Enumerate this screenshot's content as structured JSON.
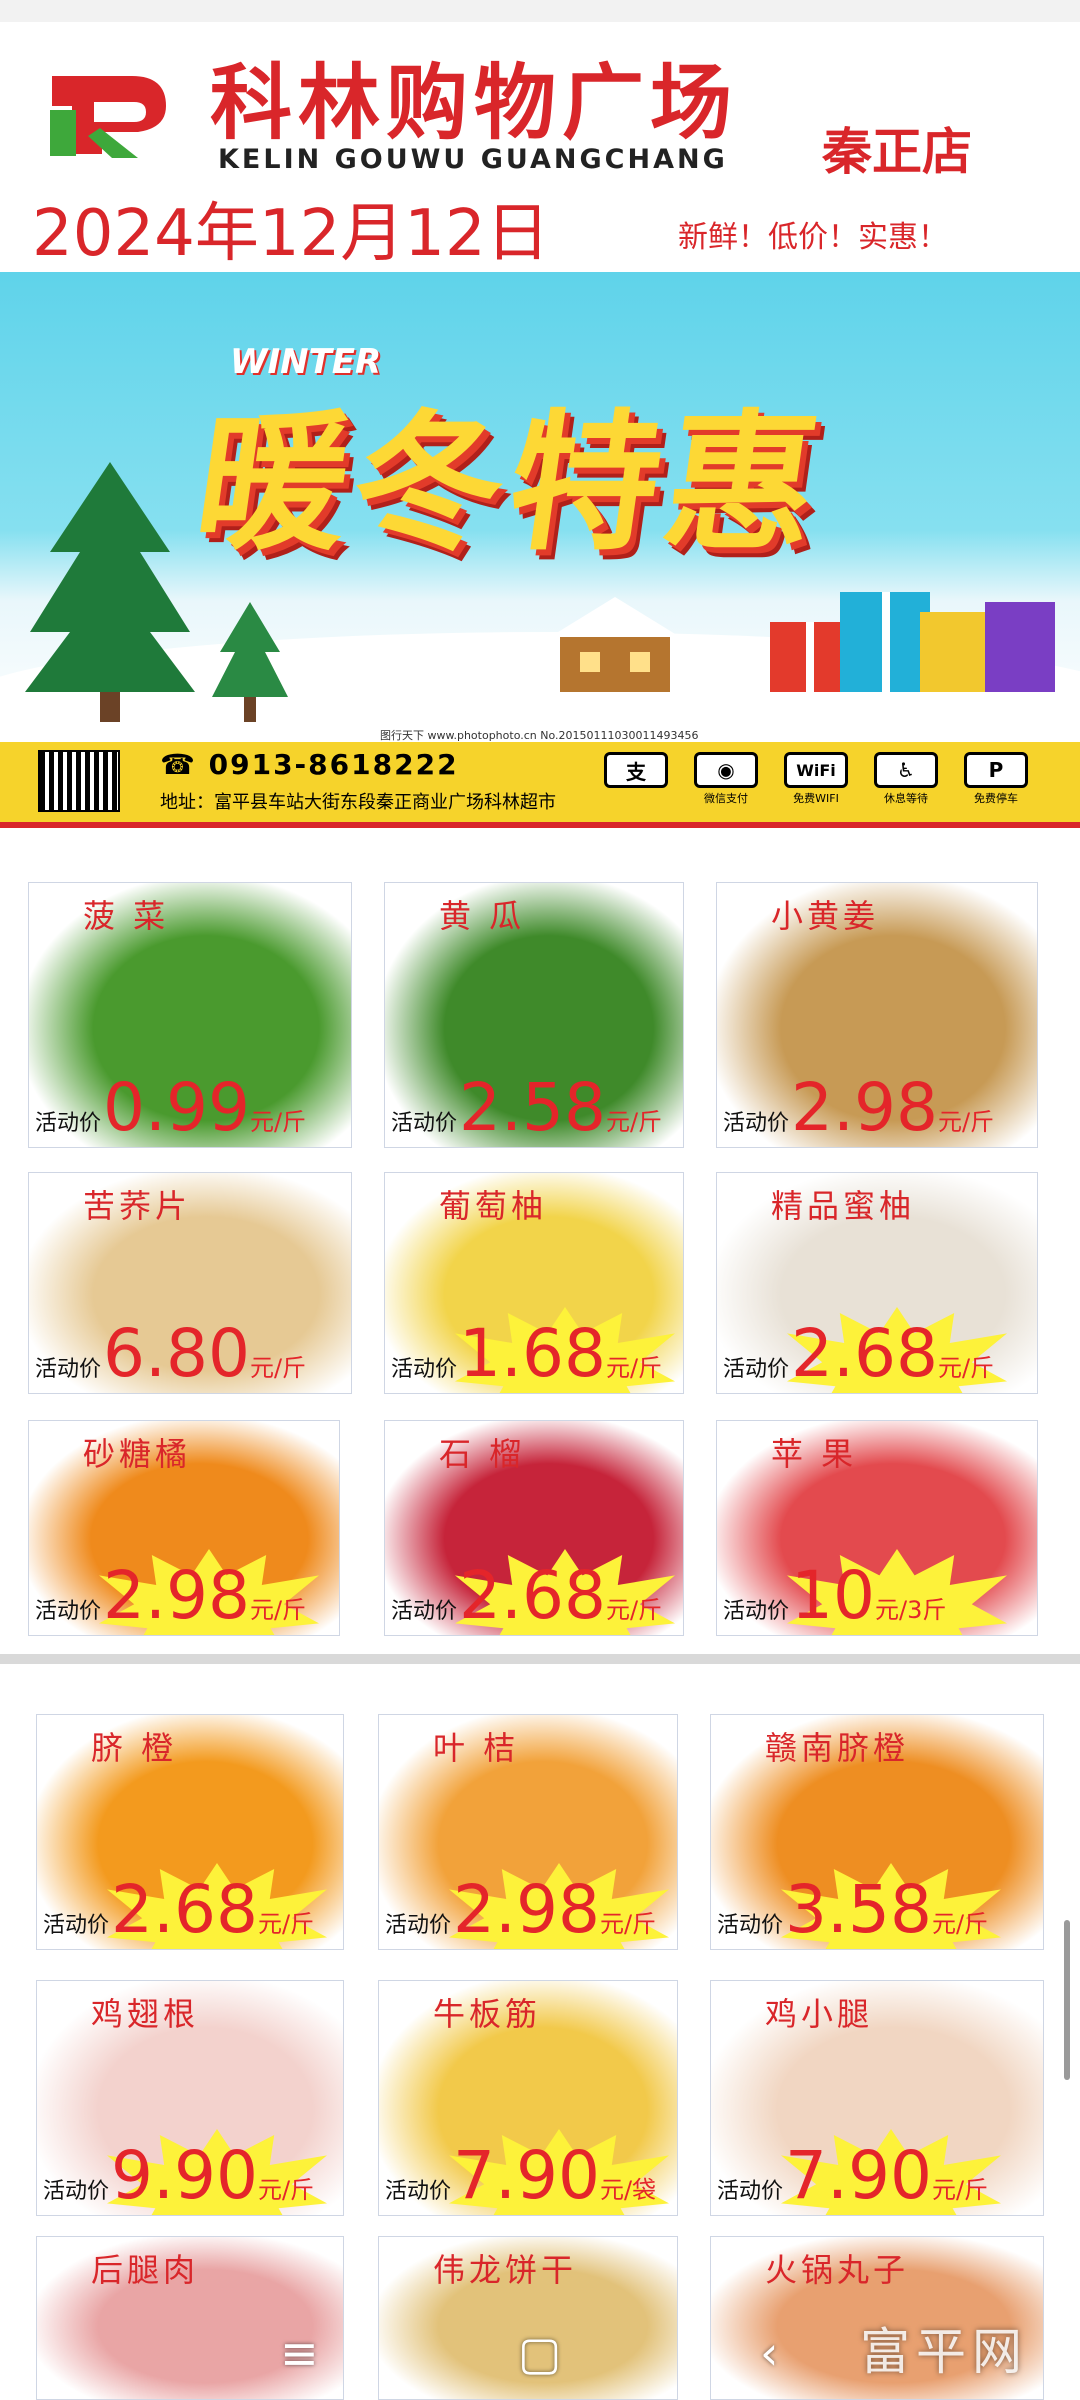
{
  "header": {
    "store_name": "科林购物广场",
    "store_pinyin": "KELIN GOUWU GUANGCHANG",
    "branch": "秦正店",
    "date": "2024年12月12日",
    "slogan": "新鲜！低价！实惠！"
  },
  "banner": {
    "winter_text": "WINTER",
    "title": "暖冬特惠",
    "stamp": "图行天下 www.photophoto.cn  No.20150111030011493456"
  },
  "info": {
    "phone": "0913-8618222",
    "address": "地址：富平县车站大街东段秦正商业广场科林超市",
    "services": [
      {
        "symbol": "支",
        "label": ""
      },
      {
        "symbol": "◉",
        "label": "微信支付"
      },
      {
        "symbol": "WiFi",
        "label": "免费WIFI"
      },
      {
        "symbol": "♿",
        "label": "休息等待"
      },
      {
        "symbol": "P",
        "label": "免费停车"
      }
    ]
  },
  "common": {
    "activity_label": "活动价",
    "unit_jin": "元/斤"
  },
  "products": [
    {
      "name": "菠 菜",
      "price": "0.99",
      "unit": "元/斤",
      "color": "#4a9a2e"
    },
    {
      "name": "黄 瓜",
      "price": "2.58",
      "unit": "元/斤",
      "color": "#3f8a2a"
    },
    {
      "name": "小黄姜",
      "price": "2.98",
      "unit": "元/斤",
      "color": "#c79a55"
    },
    {
      "name": "苦荞片",
      "price": "6.80",
      "unit": "元/斤",
      "color": "#e6c994"
    },
    {
      "name": "葡萄柚",
      "price": "1.68",
      "unit": "元/斤",
      "color": "#f2d44a"
    },
    {
      "name": "精品蜜柚",
      "price": "2.68",
      "unit": "元/斤",
      "color": "#e8e1d6"
    },
    {
      "name": "砂糖橘",
      "price": "2.98",
      "unit": "元/斤",
      "color": "#ef8a1c"
    },
    {
      "name": "石 榴",
      "price": "2.68",
      "unit": "元/斤",
      "color": "#c6243a"
    },
    {
      "name": "苹 果",
      "price": "10",
      "unit": "元/3斤",
      "color": "#e34a4e"
    },
    {
      "name": "脐 橙",
      "price": "2.68",
      "unit": "元/斤",
      "color": "#f39a1e"
    },
    {
      "name": "叶 桔",
      "price": "2.98",
      "unit": "元/斤",
      "color": "#f2a23a"
    },
    {
      "name": "赣南脐橙",
      "price": "3.58",
      "unit": "元/斤",
      "color": "#ee8e22"
    },
    {
      "name": "鸡翅根",
      "price": "9.90",
      "unit": "元/斤",
      "color": "#f3d2cd"
    },
    {
      "name": "牛板筋",
      "price": "7.90",
      "unit": "元/袋",
      "color": "#f2c94a"
    },
    {
      "name": "鸡小腿",
      "price": "7.90",
      "unit": "元/斤",
      "color": "#f1d6c2"
    },
    {
      "name": "后腿肉",
      "price": "",
      "unit": "",
      "color": "#e9a5a5"
    },
    {
      "name": "伟龙饼干",
      "price": "",
      "unit": "",
      "color": "#e2c27a"
    },
    {
      "name": "火锅丸子",
      "price": "",
      "unit": "",
      "color": "#e8a070"
    }
  ],
  "nav": {
    "menu": "≡",
    "home": "▢",
    "back": "‹"
  },
  "watermark": "富平网"
}
